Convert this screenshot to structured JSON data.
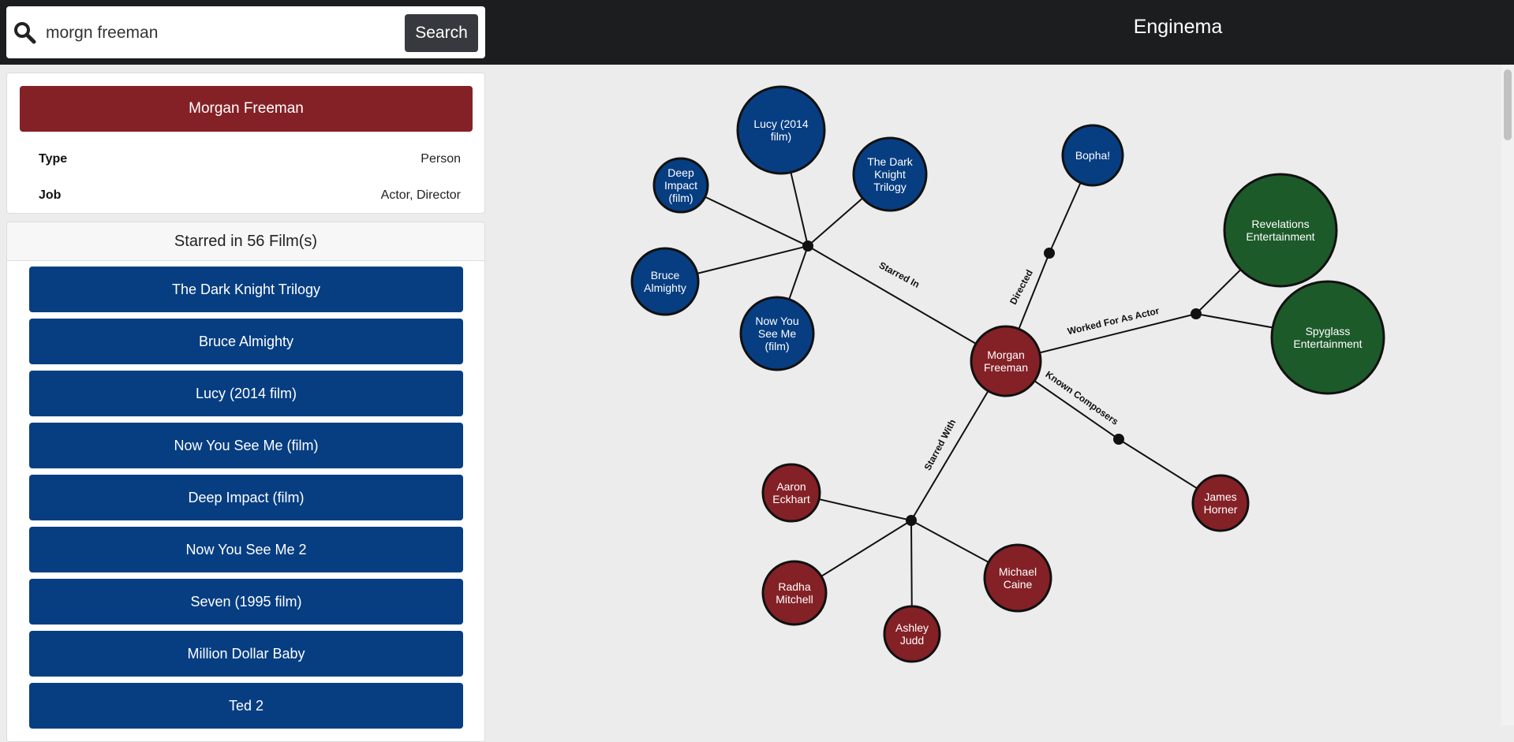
{
  "app": {
    "title": "Enginema"
  },
  "search": {
    "value": "morgn freeman",
    "button_label": "Search"
  },
  "entity": {
    "name": "Morgan Freeman",
    "fields": [
      {
        "label": "Type",
        "value": "Person"
      },
      {
        "label": "Job",
        "value": "Actor, Director"
      }
    ]
  },
  "films": {
    "header": "Starred in 56 Film(s)",
    "items": [
      "The Dark Knight Trilogy",
      "Bruce Almighty",
      "Lucy (2014 film)",
      "Now You See Me (film)",
      "Deep Impact (film)",
      "Now You See Me 2",
      "Seven (1995 film)",
      "Million Dollar Baby",
      "Ted 2"
    ]
  },
  "colors": {
    "topbar": "#1b1d1f",
    "film": "#073e82",
    "person": "#842126",
    "company": "#1d5a2a",
    "background": "#ececec"
  },
  "graph": {
    "nodes": [
      {
        "id": "center",
        "label": "Morgan Freeman",
        "kind": "person"
      },
      {
        "id": "lucy",
        "label": "Lucy (2014 film)",
        "kind": "film"
      },
      {
        "id": "deep",
        "label": "Deep Impact (film)",
        "kind": "film"
      },
      {
        "id": "dark",
        "label": "The Dark Knight Trilogy",
        "kind": "film"
      },
      {
        "id": "bruce",
        "label": "Bruce Almighty",
        "kind": "film"
      },
      {
        "id": "nysm",
        "label": "Now You See Me (film)",
        "kind": "film"
      },
      {
        "id": "bopha",
        "label": "Bopha!",
        "kind": "film"
      },
      {
        "id": "rev",
        "label": "Revelations Entertainment",
        "kind": "company"
      },
      {
        "id": "spy",
        "label": "Spyglass Entertainment",
        "kind": "company"
      },
      {
        "id": "aaron",
        "label": "Aaron Eckhart",
        "kind": "person"
      },
      {
        "id": "radha",
        "label": "Radha Mitchell",
        "kind": "person"
      },
      {
        "id": "ashley",
        "label": "Ashley Judd",
        "kind": "person"
      },
      {
        "id": "michael",
        "label": "Michael Caine",
        "kind": "person"
      },
      {
        "id": "james",
        "label": "James Horner",
        "kind": "person"
      }
    ],
    "relations": [
      {
        "label": "Starred In",
        "targets": [
          "lucy",
          "deep",
          "dark",
          "bruce",
          "nysm"
        ]
      },
      {
        "label": "Directed",
        "targets": [
          "bopha"
        ]
      },
      {
        "label": "Worked For As Actor",
        "targets": [
          "rev",
          "spy"
        ]
      },
      {
        "label": "Starred With",
        "targets": [
          "aaron",
          "radha",
          "ashley",
          "michael"
        ]
      },
      {
        "label": "Known Composers",
        "targets": [
          "james"
        ]
      }
    ]
  }
}
